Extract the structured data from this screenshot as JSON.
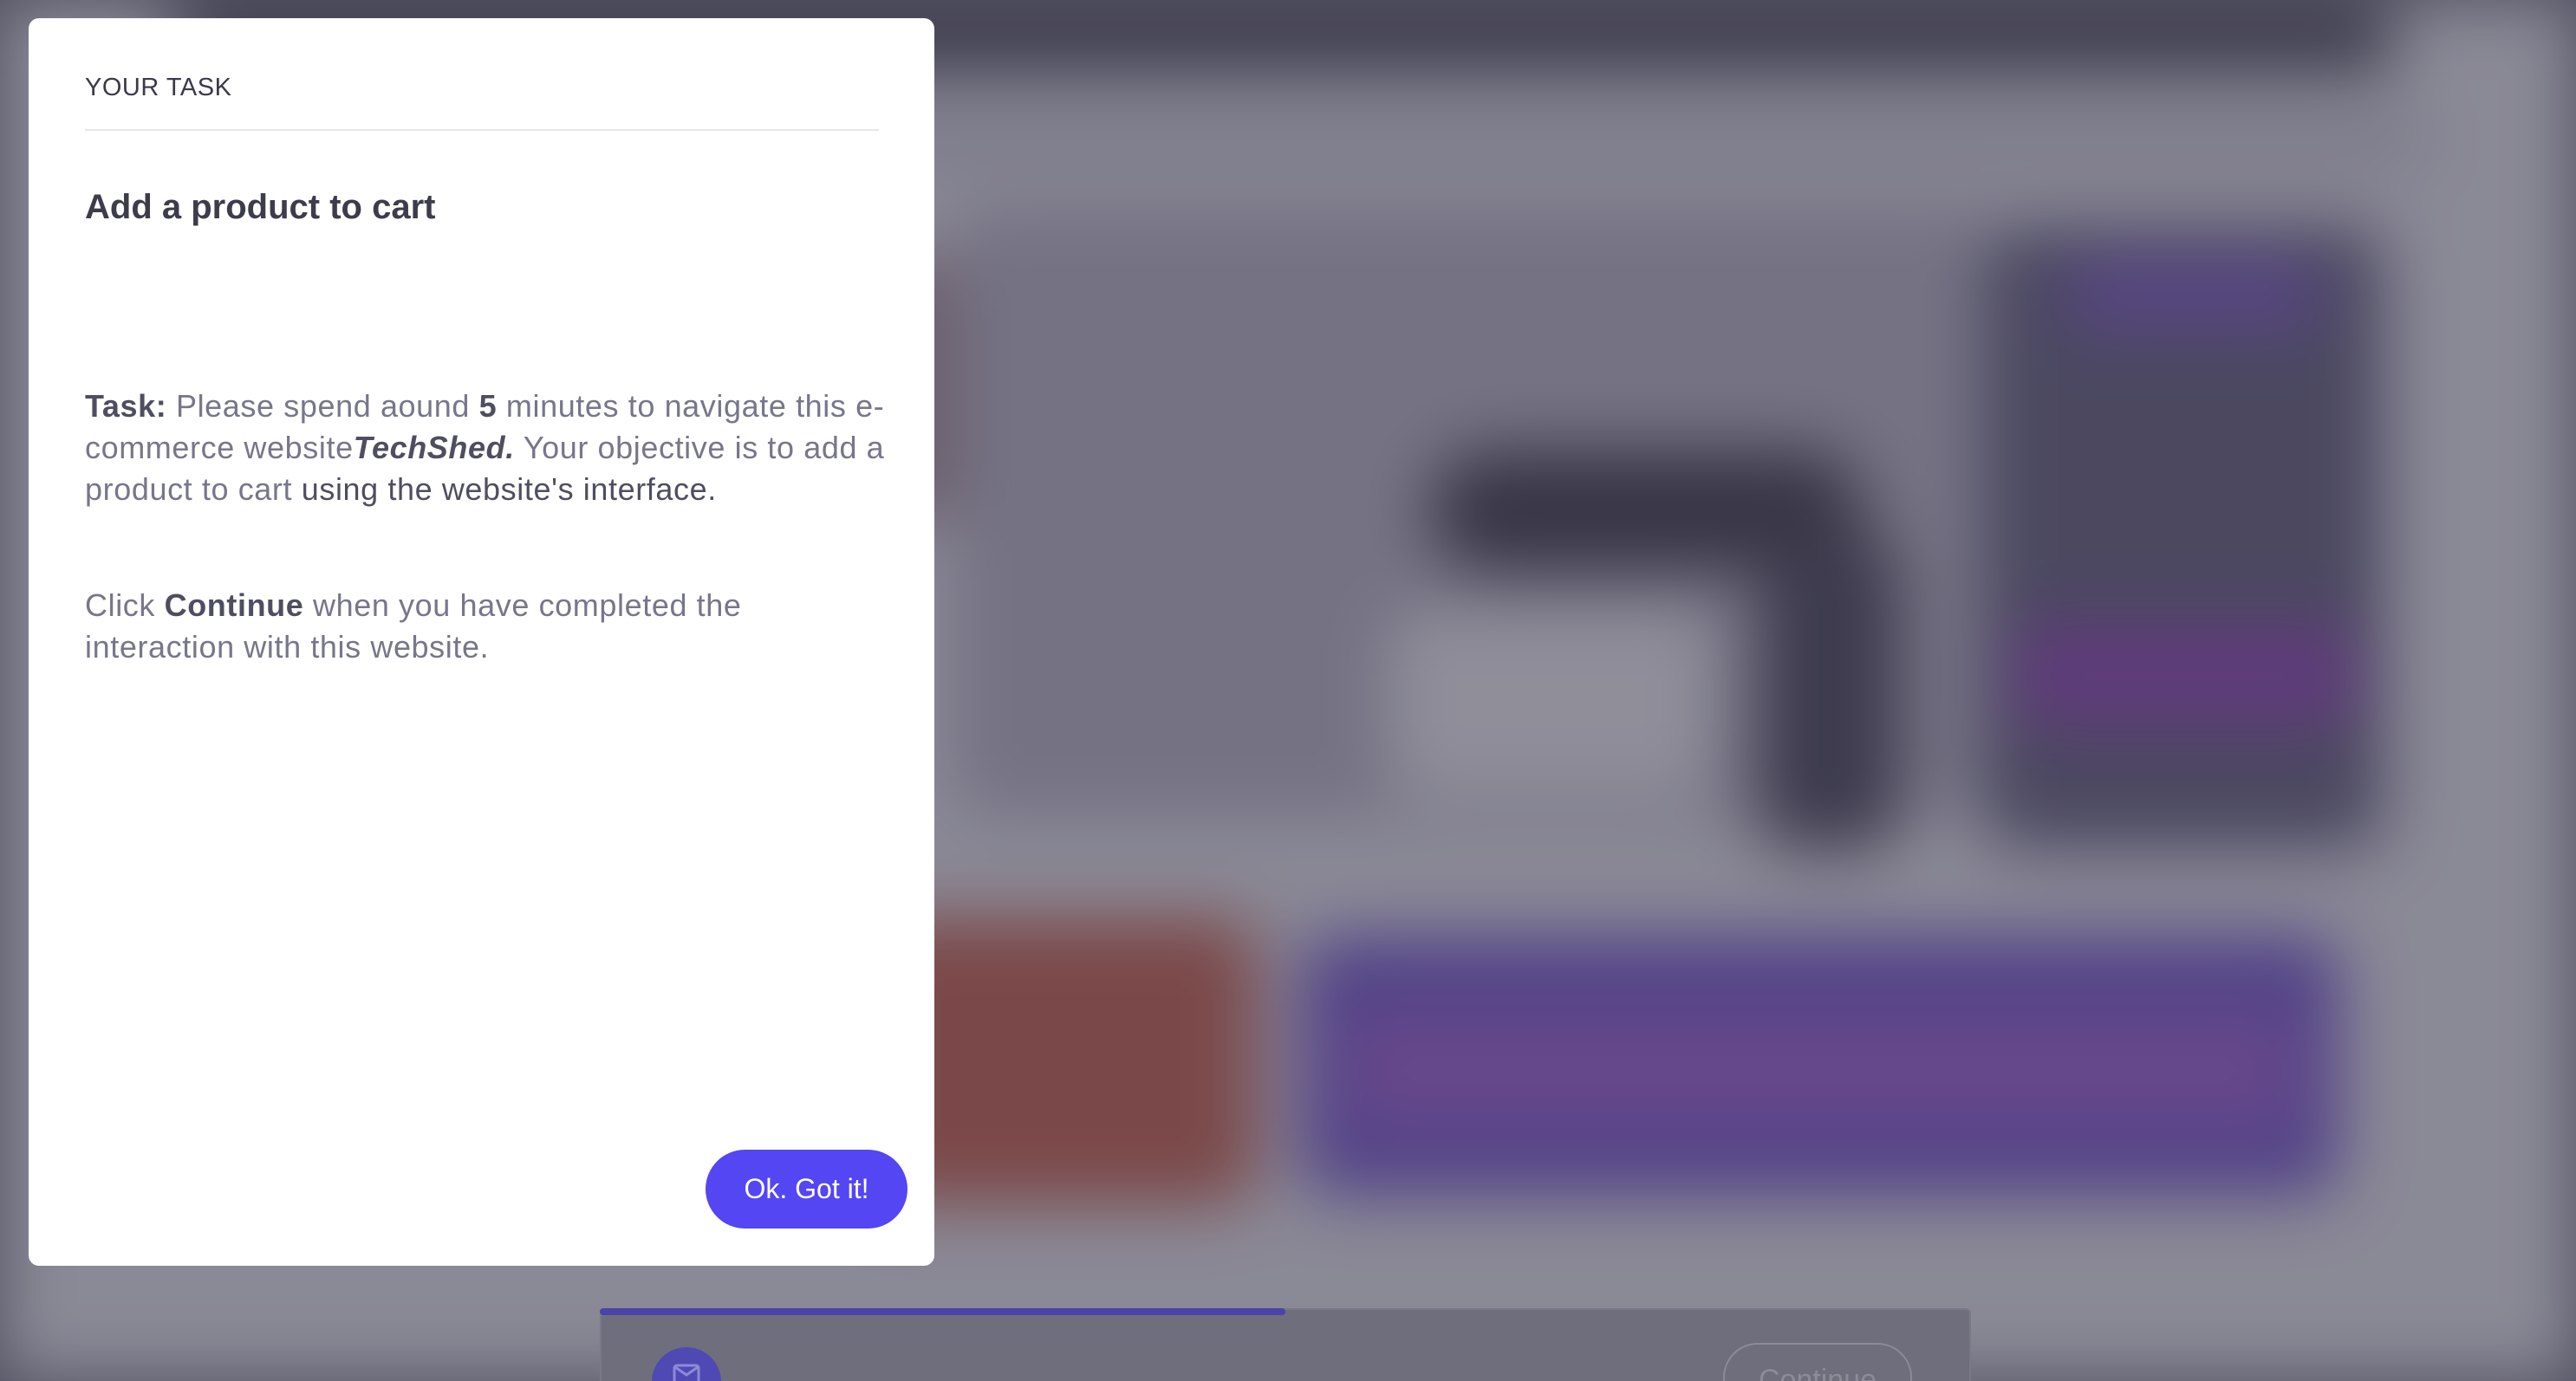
{
  "modal": {
    "eyebrow": "YOUR TASK",
    "title": "Add a product to cart",
    "task_label": "Task:",
    "task_text_1": " Please spend aound ",
    "task_minutes": "5",
    "task_text_2": " minutes to navigate this e-commerce website",
    "site_name": "TechShed.",
    "task_text_3": " Your objective is to add a product to cart ",
    "task_text_4": "using the website's interface.",
    "instruction_prefix": "Click ",
    "instruction_button_name": "Continue",
    "instruction_suffix": " when you have completed the interaction with this website.",
    "ok_button_label": "Ok. Got it!"
  },
  "footer": {
    "continue_label": "Continue",
    "progress": 0.5
  },
  "colors": {
    "accent": "#5446f2",
    "overlay": "#6b6a78"
  },
  "icons": {
    "footer_icon": "message-icon"
  }
}
